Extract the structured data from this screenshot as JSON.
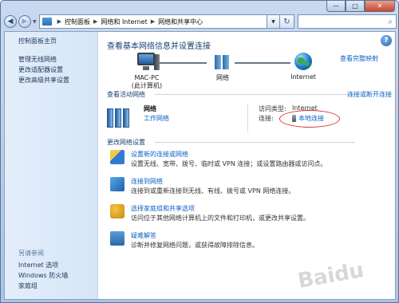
{
  "window": {
    "min_label": "—",
    "max_label": "□",
    "close_label": "✕"
  },
  "address": {
    "crumbs": [
      "控制面板",
      "网络和 Internet",
      "网络和共享中心"
    ],
    "search_placeholder": "",
    "search_icon": "search-icon"
  },
  "sidebar": {
    "home": "控制面板主页",
    "links": [
      "管理无线网络",
      "更改适配器设置",
      "更改高级共享设置"
    ],
    "see_also": "另请参阅",
    "bottom_links": [
      "Internet 选项",
      "Windows 防火墙",
      "家庭组"
    ]
  },
  "main": {
    "title": "查看基本网络信息并设置连接",
    "full_map": "查看完整映射",
    "map": {
      "pc_name": "MAC-PC",
      "pc_sub": "(此计算机)",
      "network": "网络",
      "internet": "Internet"
    },
    "active_section": "查看活动网络",
    "connect_disconnect": "连接或断开连接",
    "active": {
      "name": "网络",
      "type": "工作网络",
      "access_label": "访问类型:",
      "access_value": "Internet",
      "conn_label": "连接:",
      "conn_value": "本地连接"
    },
    "change_section": "更改网络设置",
    "tasks": [
      {
        "title": "设置新的连接或网络",
        "desc": "设置无线、宽带、拨号、临时或 VPN 连接；或设置路由器或访问点。"
      },
      {
        "title": "连接到网络",
        "desc": "连接到或重新连接到无线、有线、拨号或 VPN 网络连接。"
      },
      {
        "title": "选择家庭组和共享选项",
        "desc": "访问位于其他网络计算机上的文件和打印机，或更改共享设置。"
      },
      {
        "title": "疑难解答",
        "desc": "诊断并修复网络问题，或获得故障排除信息。"
      }
    ]
  },
  "watermark": "Baidu"
}
